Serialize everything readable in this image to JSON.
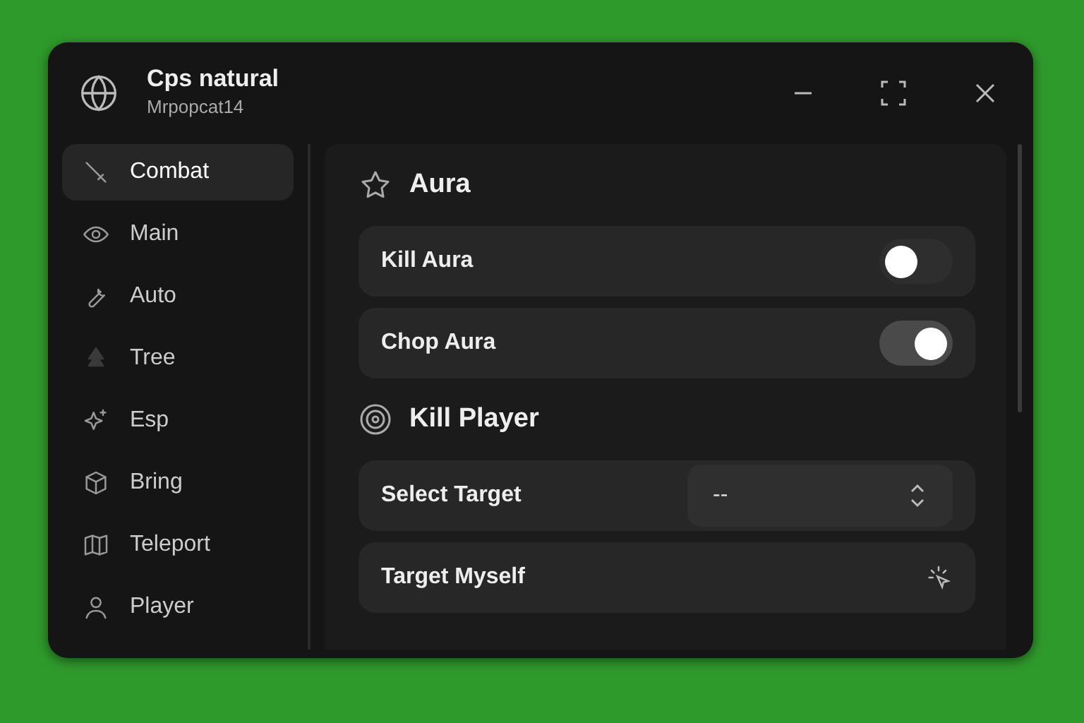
{
  "window": {
    "title": "Cps natural",
    "subtitle": "Mrpopcat14"
  },
  "sidebar": {
    "items": [
      {
        "label": "Combat",
        "selected": true
      },
      {
        "label": "Main",
        "selected": false
      },
      {
        "label": "Auto",
        "selected": false
      },
      {
        "label": "Tree",
        "selected": false
      },
      {
        "label": "Esp",
        "selected": false
      },
      {
        "label": "Bring",
        "selected": false
      },
      {
        "label": "Teleport",
        "selected": false
      },
      {
        "label": "Player",
        "selected": false
      }
    ]
  },
  "sections": [
    {
      "title": "Aura",
      "rows": [
        {
          "kind": "toggle",
          "label": "Kill Aura",
          "on": false
        },
        {
          "kind": "toggle",
          "label": "Chop Aura",
          "on": true
        }
      ]
    },
    {
      "title": "Kill Player",
      "rows": [
        {
          "kind": "select",
          "label": "Select Target",
          "value": "--"
        },
        {
          "kind": "button",
          "label": "Target Myself"
        }
      ]
    }
  ]
}
